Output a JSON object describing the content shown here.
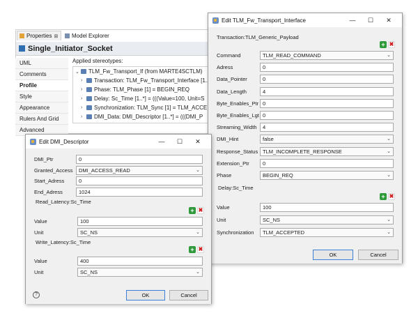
{
  "properties_view": {
    "tab_properties": "Properties",
    "tab_model_explorer": "Model Explorer",
    "element_title": "Single_Initiator_Socket",
    "side_tabs": [
      "UML",
      "Comments",
      "Profile",
      "Style",
      "Appearance",
      "Rulers And Grid",
      "Advanced"
    ],
    "applied_stereotypes_label": "Applied stereotypes:",
    "tree": [
      "TLM_Fw_Transport_If   (from MARTE4SCTLM)",
      "Transaction: TLM_Fw_Transport_Interface [1..",
      "Phase: TLM_Phase [1] = BEGIN_REQ",
      "Delay: Sc_Time [1..*] = (((Value=100, Unit=S",
      "Synchronization: TLM_Sync [1] = TLM_ACCE",
      "DMI_Data: DMI_Descriptor [1..*] = (((DMI_P"
    ]
  },
  "transport_dialog": {
    "title": "Edit TLM_Fw_Transport_Interface",
    "section_payload": "Transaction:TLM_Generic_Payload",
    "fields": [
      {
        "label": "Command",
        "value": "TLM_READ_COMMAND",
        "kind": "select"
      },
      {
        "label": "Adress",
        "value": "0",
        "kind": "text"
      },
      {
        "label": "Data_Pointer",
        "value": "0",
        "kind": "text"
      },
      {
        "label": "Data_Length",
        "value": "4",
        "kind": "text"
      },
      {
        "label": "Byte_Enables_Ptr",
        "value": "0",
        "kind": "text"
      },
      {
        "label": "Byte_Enables_Lgt",
        "value": "0",
        "kind": "text"
      },
      {
        "label": "Streaming_Width",
        "value": "4",
        "kind": "text"
      },
      {
        "label": "DMI_Hint",
        "value": "false",
        "kind": "select"
      },
      {
        "label": "Response_Status",
        "value": "TLM_INCOMPLETE_RESPONSE",
        "kind": "select"
      },
      {
        "label": "Extension_Ptr",
        "value": "0",
        "kind": "text"
      },
      {
        "label": "Phase",
        "value": "BEGIN_REQ",
        "kind": "select"
      }
    ],
    "section_delay": "Delay:Sc_Time",
    "delay_value_label": "Value",
    "delay_value": "100",
    "delay_unit_label": "Unit",
    "delay_unit": "SC_NS",
    "sync_label": "Synchronization",
    "sync_value": "TLM_ACCEPTED",
    "ok": "OK",
    "cancel": "Cancel"
  },
  "dmi_dialog": {
    "title": "Edit DMI_Descriptor",
    "fields": [
      {
        "label": "DMI_Ptr",
        "value": "0",
        "kind": "text"
      },
      {
        "label": "Granted_Access",
        "value": "DMI_ACCESS_READ",
        "kind": "select"
      },
      {
        "label": "Start_Adress",
        "value": "0",
        "kind": "text"
      },
      {
        "label": "End_Adress",
        "value": "1024",
        "kind": "text"
      }
    ],
    "section_read": "Read_Latency:Sc_Time",
    "read_value_label": "Value",
    "read_value": "100",
    "read_unit_label": "Unit",
    "read_unit": "SC_NS",
    "section_write": "Write_Latency:Sc_Time",
    "write_value_label": "Value",
    "write_value": "400",
    "write_unit_label": "Unit",
    "write_unit": "SC_NS",
    "ok": "OK",
    "cancel": "Cancel"
  },
  "common": {
    "minimize": "—",
    "maximize": "☐",
    "close": "✕",
    "help": "?",
    "plus": "+",
    "remove": "✖",
    "dropdown_arrow": "⌄"
  }
}
